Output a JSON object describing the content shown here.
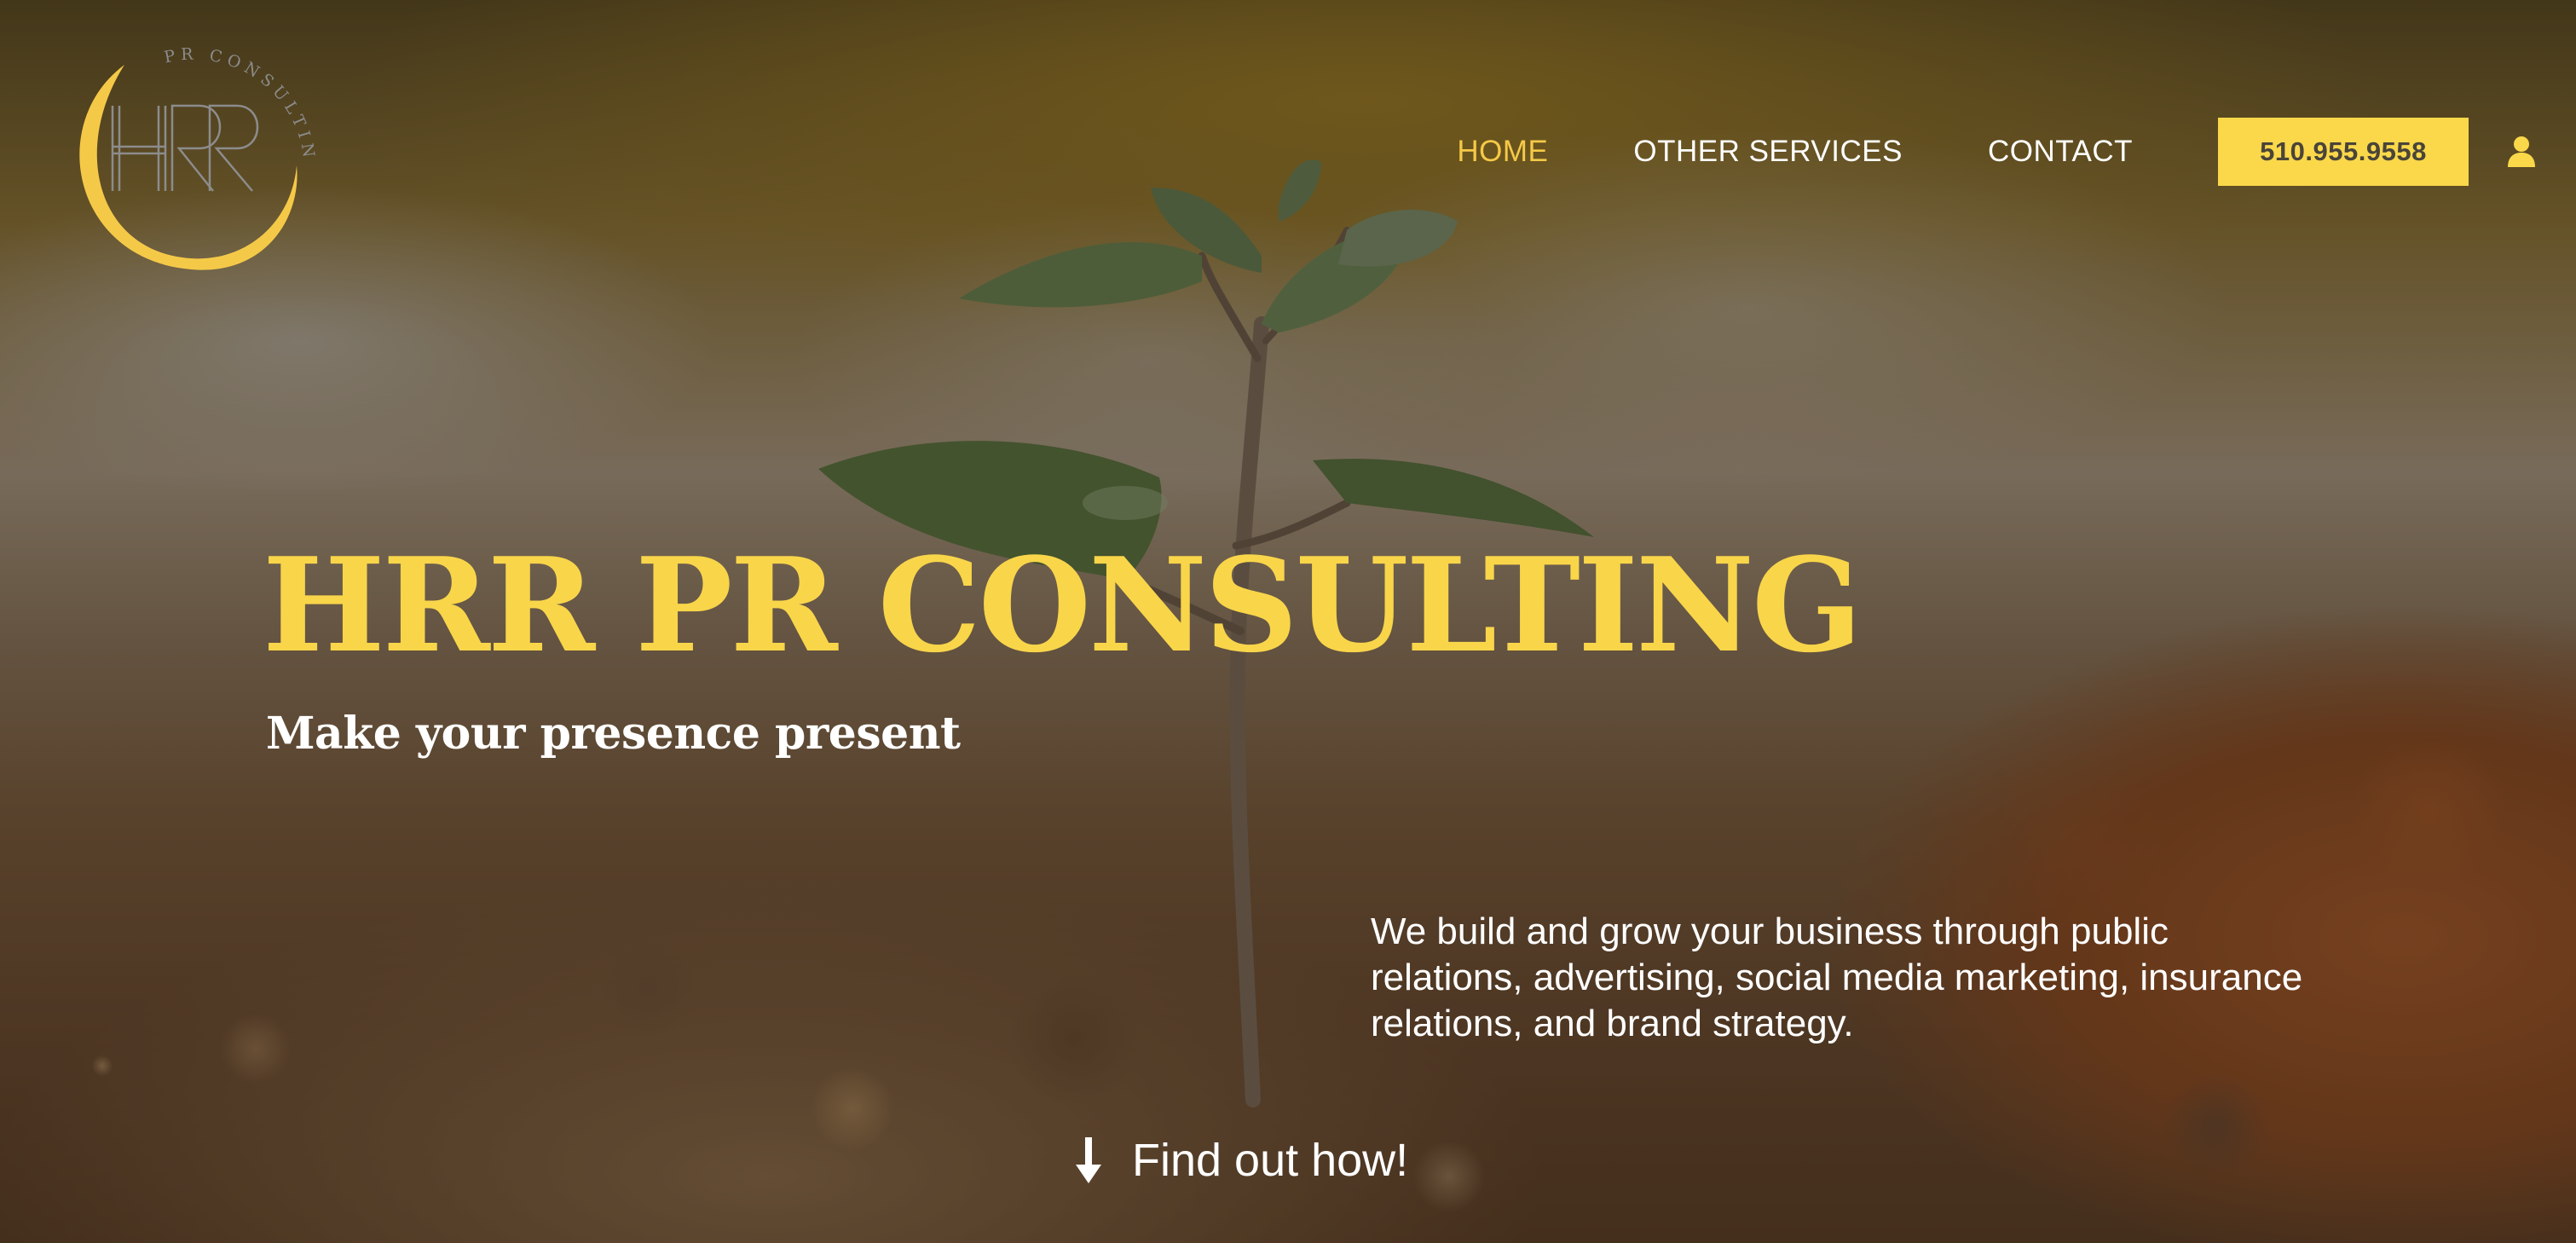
{
  "brand": {
    "logo_monogram": "HRR",
    "logo_arc_text": "PR CONSULTING",
    "accent_color": "#fad84a"
  },
  "nav": {
    "items": [
      {
        "label": "HOME",
        "active": true
      },
      {
        "label": "OTHER SERVICES",
        "active": false
      },
      {
        "label": "CONTACT",
        "active": false
      }
    ],
    "phone_label": "510.955.9558",
    "user_icon": "user-icon"
  },
  "hero": {
    "title": "HRR PR CONSULTING",
    "subtitle": "Make your presence present",
    "description": "We build and grow your business through public relations, advertising, social media marketing, insurance relations, and brand strategy.",
    "cta_icon": "arrow-down-icon",
    "cta_label": "Find out how!"
  }
}
